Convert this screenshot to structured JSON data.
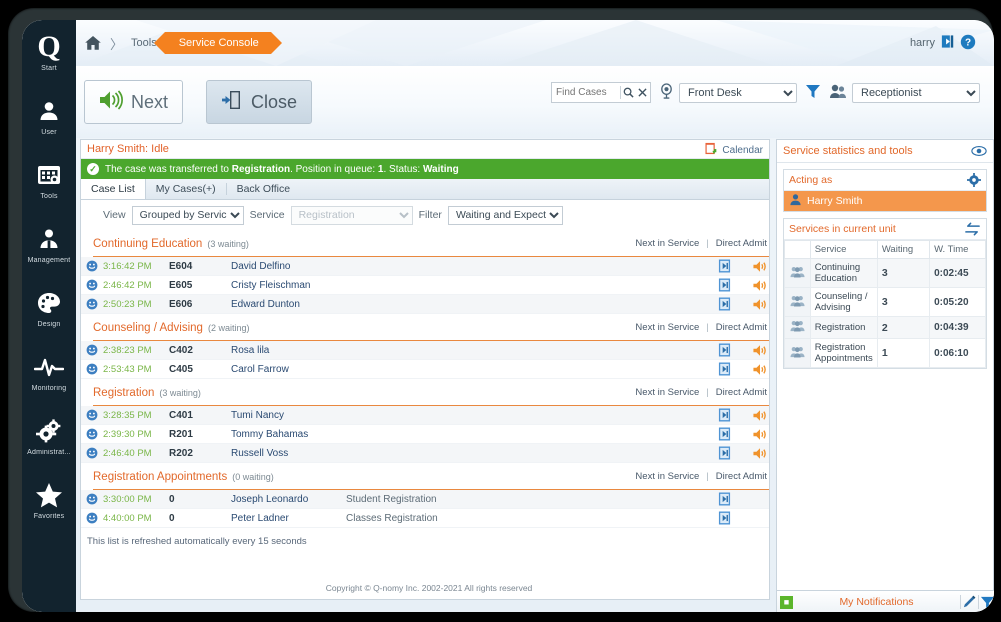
{
  "app": {
    "user_label": "harry",
    "copyright": "Copyright © Q-nomy Inc. 2002-2021 All rights reserved"
  },
  "breadcrumb": {
    "home_icon": "home-icon",
    "separator": "〉",
    "parent": "Tools",
    "current": "Service Console"
  },
  "sidebar": {
    "logo": "Q",
    "items": [
      {
        "label": "Start",
        "icon": "q-logo-icon"
      },
      {
        "label": "User",
        "icon": "user-icon"
      },
      {
        "label": "Tools",
        "icon": "calendar-tools-icon"
      },
      {
        "label": "Management",
        "icon": "management-person-icon"
      },
      {
        "label": "Design",
        "icon": "palette-icon"
      },
      {
        "label": "Monitoring",
        "icon": "pulse-icon"
      },
      {
        "label": "Administrat...",
        "icon": "gears-icon"
      },
      {
        "label": "Favorites",
        "icon": "star-icon"
      }
    ]
  },
  "toolbar": {
    "next_label": "Next",
    "next_icon": "speaker-icon",
    "close_label": "Close",
    "close_icon": "exit-door-icon",
    "search": {
      "placeholder": "Find Cases",
      "value": "",
      "search_icon": "search-icon",
      "clear_icon": "close-icon"
    },
    "unit_select": {
      "icon": "location-pin-icon",
      "value": "Front Desk",
      "options": [
        "Front Desk"
      ]
    },
    "filter_icon": "funnel-icon",
    "role_select": {
      "icon": "people-icon",
      "value": "Receptionist",
      "options": [
        "Receptionist"
      ]
    }
  },
  "status": {
    "agent_state": "Harry Smith: Idle",
    "calendar_label": "Calendar",
    "calendar_icon": "calendar-icon",
    "message_icon": "check-circle-icon",
    "message_pre": "The case was transferred to ",
    "message_service": "Registration",
    "message_mid": ". Position in queue: ",
    "message_position": "1",
    "message_status_label": ". Status: ",
    "message_status": "Waiting"
  },
  "tabs": [
    {
      "label": "Case List",
      "active": true
    },
    {
      "label": "My Cases(+)",
      "active": false
    },
    {
      "label": "Back Office",
      "active": false
    }
  ],
  "filters": {
    "view_label": "View",
    "view_value": "Grouped by Service",
    "view_options": [
      "Grouped by Service"
    ],
    "service_label": "Service",
    "service_value": "Registration",
    "service_options": [
      "Registration"
    ],
    "filter_label": "Filter",
    "filter_value": "Waiting and Expected",
    "filter_options": [
      "Waiting and Expected"
    ]
  },
  "group_actions": {
    "next_in_service": "Next in Service",
    "separator": "|",
    "direct_admit": "Direct Admit"
  },
  "case_groups": [
    {
      "title": "Continuing Education",
      "count": "(3 waiting)",
      "rows": [
        {
          "icon": "smiley-icon",
          "time": "3:16:42 PM",
          "ticket": "E604",
          "name": "David Delfino",
          "extra": "",
          "next_icon": "next-in-service-icon",
          "admit_icon": "direct-admit-icon"
        },
        {
          "icon": "smiley-icon",
          "time": "2:46:42 PM",
          "ticket": "E605",
          "name": "Cristy Fleischman",
          "extra": "",
          "next_icon": "next-in-service-icon",
          "admit_icon": "direct-admit-icon"
        },
        {
          "icon": "smiley-icon",
          "time": "2:50:23 PM",
          "ticket": "E606",
          "name": "Edward Dunton",
          "extra": "",
          "next_icon": "next-in-service-icon",
          "admit_icon": "direct-admit-icon"
        }
      ]
    },
    {
      "title": "Counseling / Advising",
      "count": "(2 waiting)",
      "rows": [
        {
          "icon": "smiley-icon",
          "time": "2:38:23 PM",
          "ticket": "C402",
          "name": "Rosa lila",
          "extra": "",
          "next_icon": "next-in-service-icon",
          "admit_icon": "direct-admit-icon"
        },
        {
          "icon": "smiley-icon",
          "time": "2:53:43 PM",
          "ticket": "C405",
          "name": "Carol Farrow",
          "extra": "",
          "next_icon": "next-in-service-icon",
          "admit_icon": "direct-admit-icon"
        }
      ]
    },
    {
      "title": "Registration",
      "count": "(3 waiting)",
      "rows": [
        {
          "icon": "smiley-icon",
          "time": "3:28:35 PM",
          "ticket": "C401",
          "name": "Tumi Nancy",
          "extra": "",
          "next_icon": "next-in-service-icon",
          "admit_icon": "direct-admit-icon"
        },
        {
          "icon": "smiley-icon",
          "time": "2:39:30 PM",
          "ticket": "R201",
          "name": "Tommy Bahamas",
          "extra": "",
          "next_icon": "next-in-service-icon",
          "admit_icon": "direct-admit-icon"
        },
        {
          "icon": "smiley-icon",
          "time": "2:46:40 PM",
          "ticket": "R202",
          "name": "Russell Voss",
          "extra": "",
          "next_icon": "next-in-service-icon",
          "admit_icon": "direct-admit-icon"
        }
      ]
    },
    {
      "title": "Registration Appointments",
      "count": "(0 waiting)",
      "rows": [
        {
          "icon": "smiley-icon",
          "time": "3:30:00 PM",
          "ticket": "0",
          "name": "Joseph Leonardo",
          "extra": "Student Registration",
          "next_icon": "next-in-service-icon",
          "admit_icon": ""
        },
        {
          "icon": "smiley-icon",
          "time": "4:40:00 PM",
          "ticket": "0",
          "name": "Peter Ladner",
          "extra": "Classes Registration",
          "next_icon": "next-in-service-icon",
          "admit_icon": ""
        }
      ]
    }
  ],
  "refresh_note": "This list is refreshed automatically every 15 seconds",
  "right_panel": {
    "title": "Service statistics and tools",
    "eye_icon": "eye-icon",
    "acting_as": {
      "title": "Acting as",
      "gear_icon": "gear-icon",
      "user_icon": "user-icon",
      "user_name": "Harry Smith"
    },
    "services": {
      "title": "Services in current unit",
      "swap_icon": "swap-arrows-icon",
      "columns": [
        "",
        "Service",
        "Waiting",
        "W. Time"
      ],
      "rows": [
        {
          "icon": "people-icon",
          "service": "Continuing Education",
          "waiting": "3",
          "wtime": "0:02:45"
        },
        {
          "icon": "people-icon",
          "service": "Counseling / Advising",
          "waiting": "3",
          "wtime": "0:05:20"
        },
        {
          "icon": "people-icon",
          "service": "Registration",
          "waiting": "2",
          "wtime": "0:04:39"
        },
        {
          "icon": "people-icon",
          "service": "Registration Appointments",
          "waiting": "1",
          "wtime": "0:06:10"
        }
      ]
    }
  },
  "notifications": {
    "badge_icon": "note-icon",
    "title": "My Notifications",
    "edit_icon": "pencil-icon",
    "filter_icon": "funnel-icon"
  },
  "colors": {
    "accent_orange": "#e2692b",
    "brand_orange": "#f4811f",
    "success_green": "#4ba72d",
    "rail_dark": "#12232e",
    "time_green": "#7ab648",
    "link_blue": "#2a4a72"
  }
}
